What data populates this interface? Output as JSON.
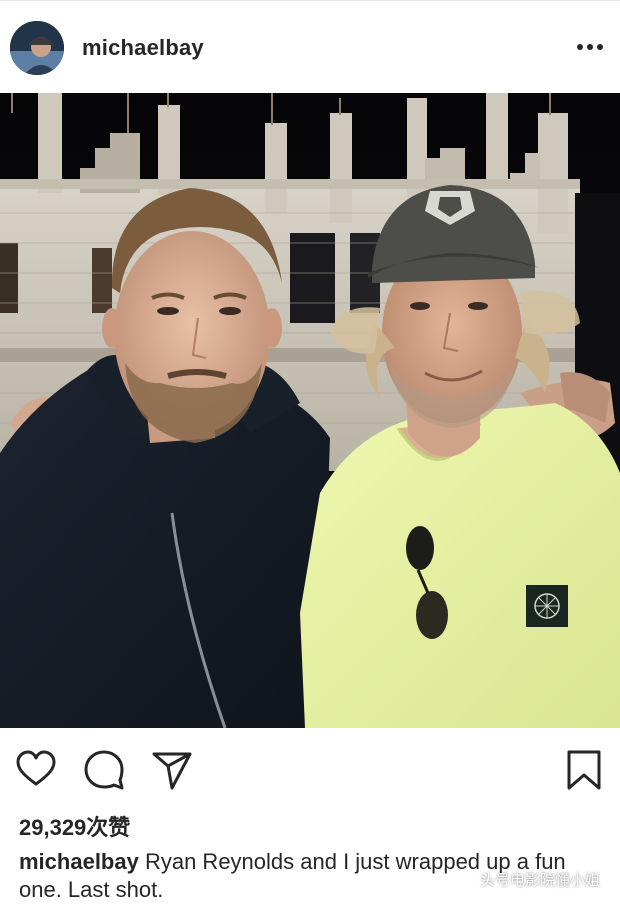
{
  "post": {
    "username": "michaelbay",
    "more_label": "•••",
    "likes": "29,329次赞",
    "caption_user": "michaelbay",
    "caption_text": " Ryan Reynolds and I just wrapped up a fun one. Last shot."
  },
  "actions": {
    "like_icon": "heart-icon",
    "comment_icon": "comment-icon",
    "share_icon": "send-icon",
    "save_icon": "bookmark-icon"
  },
  "watermark": {
    "text": "头号电影院懂小姐"
  },
  "colors": {
    "text": "#262626",
    "icon": "#262626",
    "shirt_yellow": "#e9f3a0"
  }
}
